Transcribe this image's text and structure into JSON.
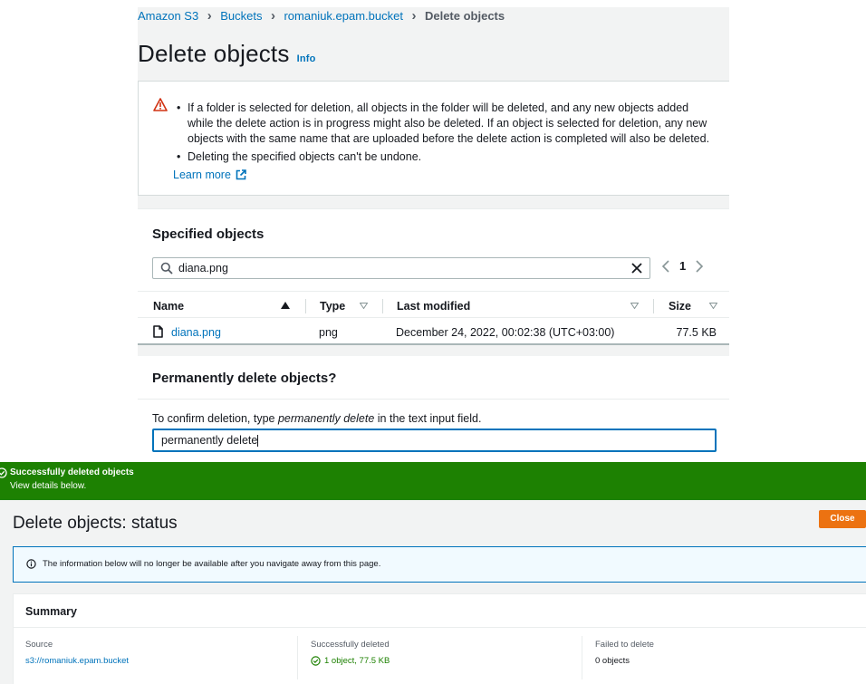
{
  "breadcrumb": [
    "Amazon S3",
    "Buckets",
    "romaniuk.epam.bucket",
    "Delete objects"
  ],
  "page": {
    "title": "Delete objects",
    "info": "Info"
  },
  "warning": {
    "items": [
      "If a folder is selected for deletion, all objects in the folder will be deleted, and any new objects added while the delete action is in progress might also be deleted. If an object is selected for deletion, any new objects with the same name that are uploaded before the delete action is completed will also be deleted.",
      "Deleting the specified objects can't be undone."
    ],
    "learn_more": "Learn more"
  },
  "specified": {
    "title": "Specified objects",
    "search_value": "diana.png",
    "page_number": "1",
    "columns": {
      "name": "Name",
      "type": "Type",
      "modified": "Last modified",
      "size": "Size"
    },
    "rows": [
      {
        "name": "diana.png",
        "type": "png",
        "modified": "December 24, 2022, 00:02:38 (UTC+03:00)",
        "size": "77.5 KB"
      }
    ]
  },
  "confirm": {
    "title": "Permanently delete objects?",
    "text_before": "To confirm deletion, type ",
    "text_em": "permanently delete",
    "text_after": " in the text input field.",
    "input_value": "permanently delete"
  },
  "flash": {
    "title": "Successfully deleted objects",
    "subtitle": "View details below."
  },
  "status": {
    "title": "Delete objects: status",
    "close": "Close",
    "info": "The information below will no longer be available after you navigate away from this page.",
    "summary": {
      "title": "Summary",
      "source_label": "Source",
      "source_value": "s3://romaniuk.epam.bucket",
      "success_label": "Successfully deleted",
      "success_value": "1 object, 77.5 KB",
      "failed_label": "Failed to delete",
      "failed_value": "0 objects"
    }
  },
  "colors": {
    "link": "#0073bb",
    "success": "#1d8102",
    "primary_button": "#ec7211",
    "warning": "#d13212"
  }
}
